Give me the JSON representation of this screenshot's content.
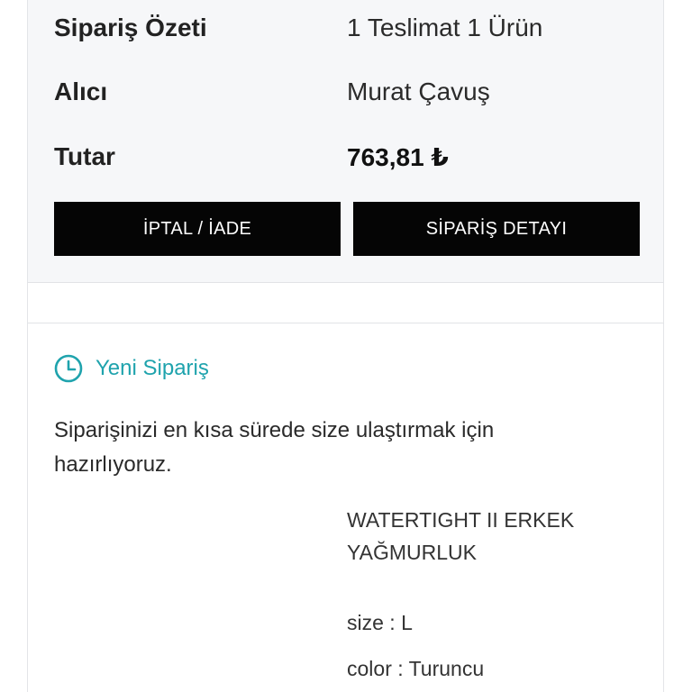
{
  "summary": {
    "order_summary_label": "Sipariş Özeti",
    "order_summary_value": "1 Teslimat 1 Ürün",
    "recipient_label": "Alıcı",
    "recipient_value": "Murat Çavuş",
    "total_label": "Tutar",
    "total_value": "763,81 ₺"
  },
  "buttons": {
    "cancel_return": "İPTAL / İADE",
    "order_detail": "SİPARİŞ DETAYI"
  },
  "status": {
    "icon": "clock-icon",
    "title": "Yeni Sipariş",
    "description": "Siparişinizi en kısa sürede size ulaştırmak için hazırlıyoruz.",
    "accent_color": "#1fa3ad"
  },
  "product": {
    "name": "WATERTIGHT II ERKEK YAĞMURLUK",
    "size": "size : L",
    "color": "color : Turuncu"
  }
}
